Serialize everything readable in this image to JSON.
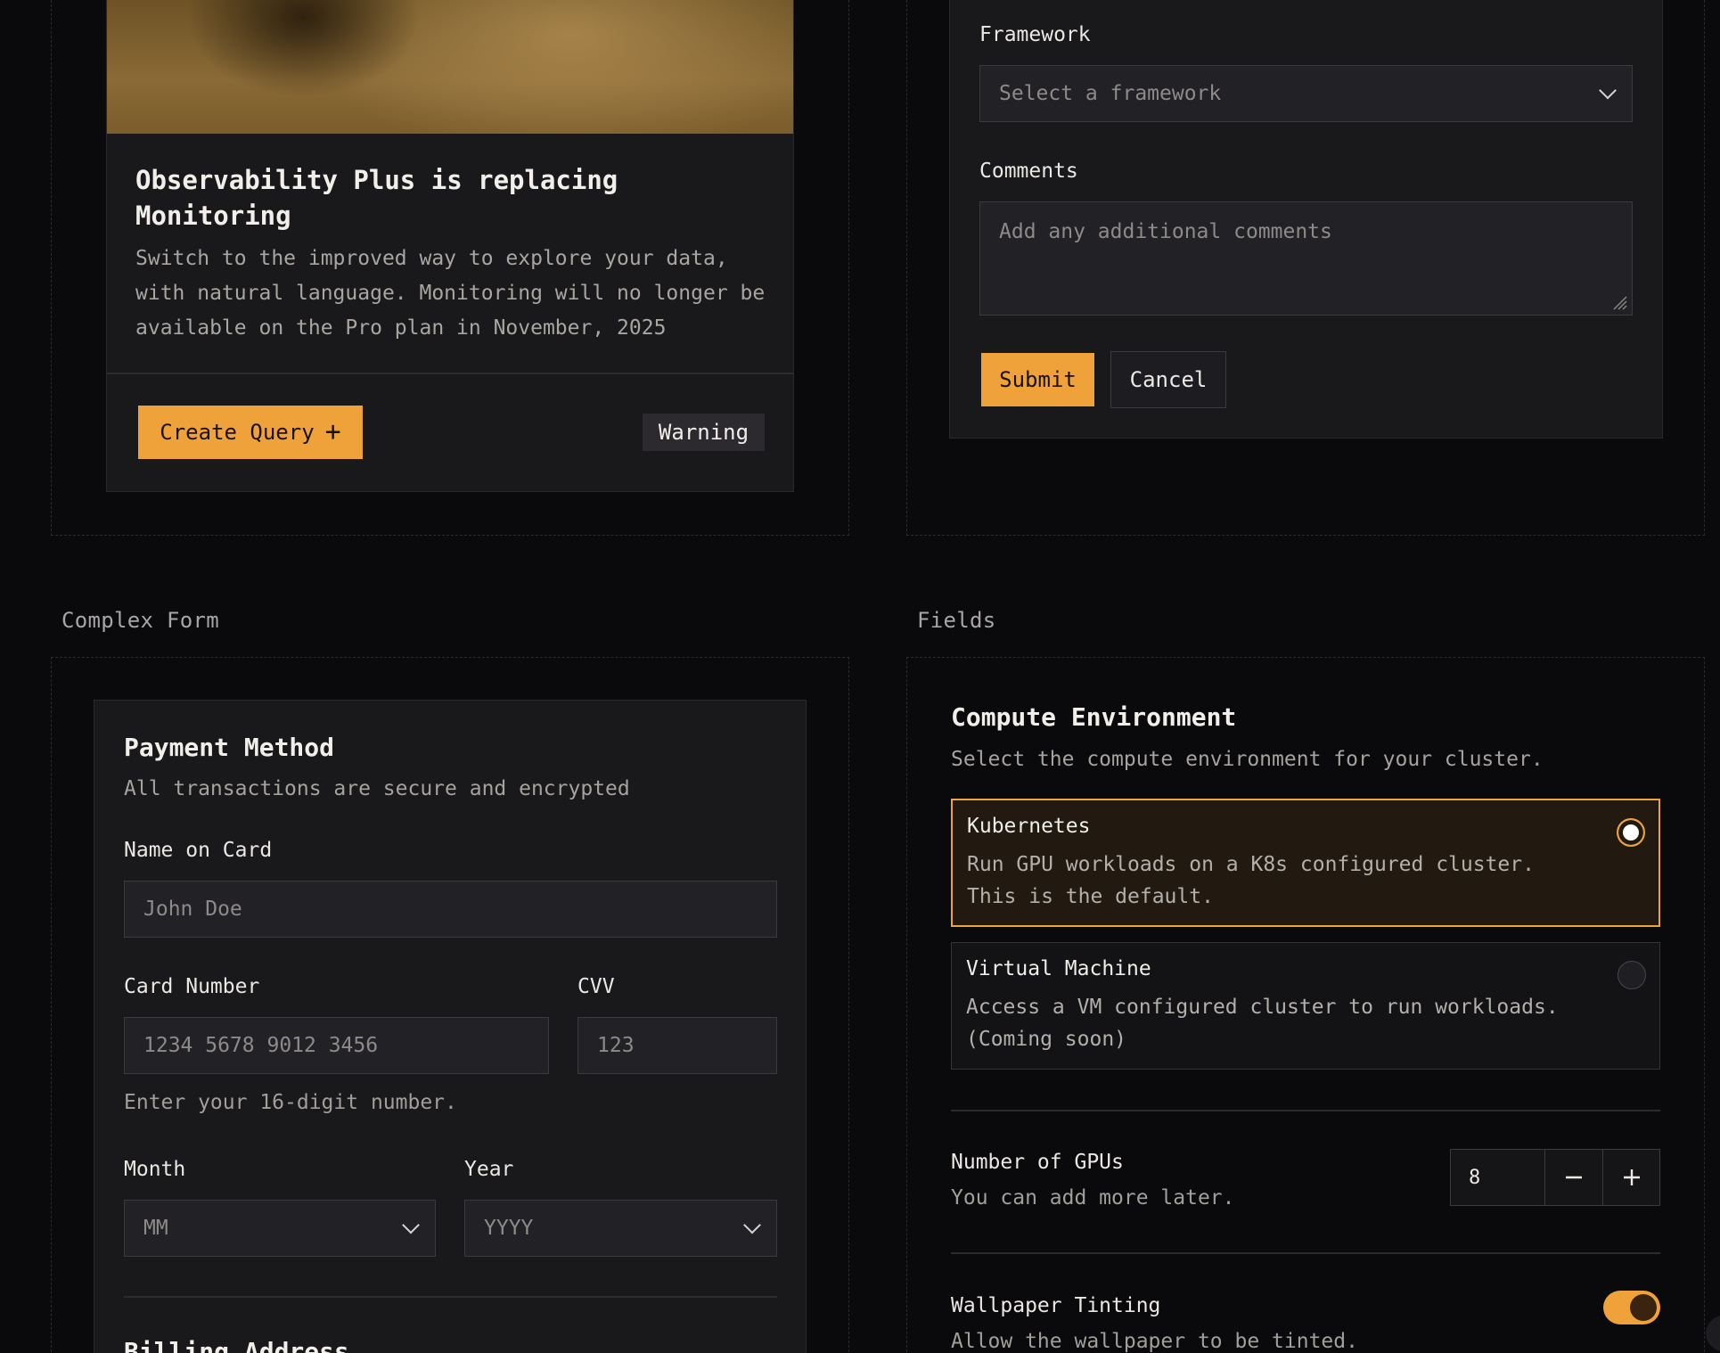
{
  "notice": {
    "title": "Observability Plus is replacing Monitoring",
    "description": "Switch to the improved way to explore your data, with natural language. Monitoring will no longer be available on the Pro plan in November, 2025",
    "create_label": "Create Query",
    "badge": "Warning"
  },
  "project_form": {
    "framework_label": "Framework",
    "framework_placeholder": "Select a framework",
    "comments_label": "Comments",
    "comments_placeholder": "Add any additional comments",
    "submit_label": "Submit",
    "cancel_label": "Cancel"
  },
  "sections": {
    "complex_form": "Complex Form",
    "fields": "Fields"
  },
  "payment": {
    "title": "Payment Method",
    "subtitle": "All transactions are secure and encrypted",
    "name_label": "Name on Card",
    "name_placeholder": "John Doe",
    "card_label": "Card Number",
    "card_placeholder": "1234 5678 9012 3456",
    "cvv_label": "CVV",
    "cvv_placeholder": "123",
    "card_hint": "Enter your 16-digit number.",
    "month_label": "Month",
    "month_placeholder": "MM",
    "year_label": "Year",
    "year_placeholder": "YYYY",
    "billing_title": "Billing Address"
  },
  "compute": {
    "title": "Compute Environment",
    "subtitle": "Select the compute environment for your cluster.",
    "options": [
      {
        "title": "Kubernetes",
        "desc": "Run GPU workloads on a K8s configured cluster. This is the default.",
        "selected": true
      },
      {
        "title": "Virtual Machine",
        "desc": "Access a VM configured cluster to run workloads. (Coming soon)",
        "selected": false
      }
    ],
    "gpus_label": "Number of GPUs",
    "gpus_hint": "You can add more later.",
    "gpus_value": "8",
    "tint_label": "Wallpaper Tinting",
    "tint_hint": "Allow the wallpaper to be tinted.",
    "tint_on": true
  },
  "colors": {
    "accent": "#f0a23a",
    "background": "#0a090c",
    "card": "#19181b"
  }
}
